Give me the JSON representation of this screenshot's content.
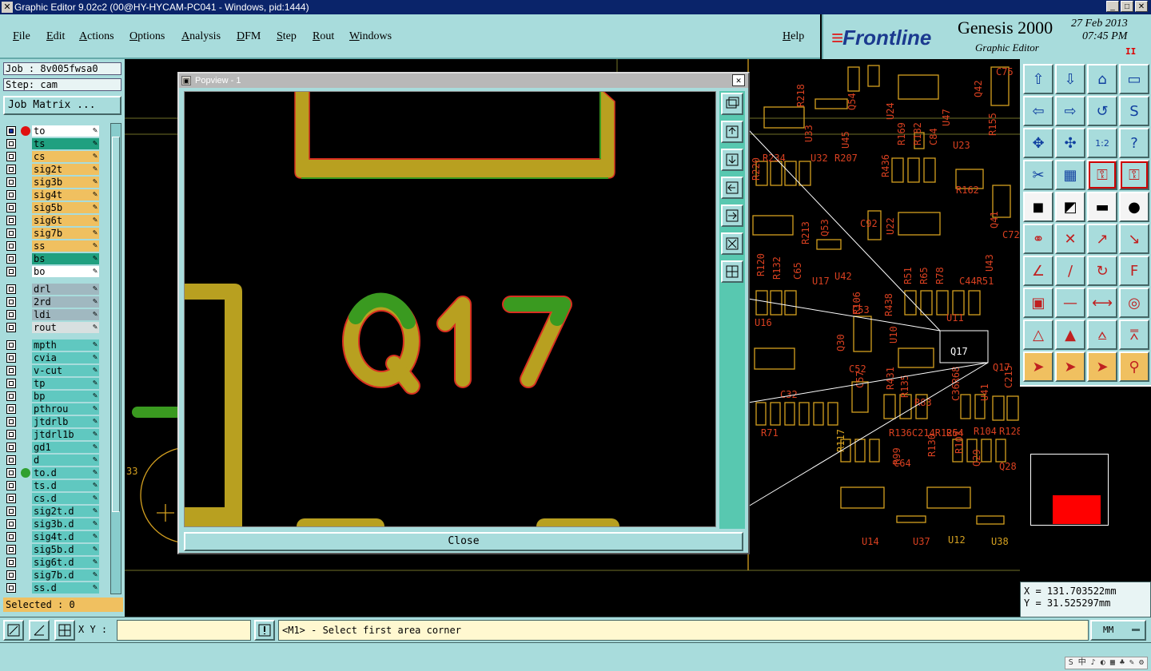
{
  "window": {
    "title": "Graphic Editor 9.02c2 (00@HY-HYCAM-PC041 - Windows, pid:1444)"
  },
  "menu": [
    "File",
    "Edit",
    "Actions",
    "Options",
    "Analysis",
    "DFM",
    "Step",
    "Rout",
    "Windows"
  ],
  "help_label": "Help",
  "brand": {
    "logo": "Frontline",
    "product": "Genesis 2000",
    "subtitle": "Graphic Editor",
    "date": "27 Feb 2013",
    "time": "07:45 PM",
    "pause_glyph": "II"
  },
  "job": {
    "job_line": "Job : 8v005fwsa0",
    "step_line": "Step: cam",
    "matrix_button": "Job Matrix ..."
  },
  "layers": [
    {
      "name": "to",
      "color": "#ffffff",
      "dot": "#e01010",
      "active": true
    },
    {
      "name": "ts",
      "color": "#20a080"
    },
    {
      "name": "cs",
      "color": "#f0c060"
    },
    {
      "name": "sig2t",
      "color": "#f0c060"
    },
    {
      "name": "sig3b",
      "color": "#f0c060"
    },
    {
      "name": "sig4t",
      "color": "#f0c060"
    },
    {
      "name": "sig5b",
      "color": "#f0c060"
    },
    {
      "name": "sig6t",
      "color": "#f0c060"
    },
    {
      "name": "sig7b",
      "color": "#f0c060"
    },
    {
      "name": "ss",
      "color": "#f0c060"
    },
    {
      "name": "bs",
      "color": "#20a080"
    },
    {
      "name": "bo",
      "color": "#ffffff"
    },
    {
      "name": "drl",
      "color": "#a0b8c0"
    },
    {
      "name": "2rd",
      "color": "#a0b8c0"
    },
    {
      "name": "ldi",
      "color": "#a0b8c0"
    },
    {
      "name": "rout",
      "color": "#d8e0e0"
    },
    {
      "name": "mpth",
      "color": "#60c8c0"
    },
    {
      "name": "cvia",
      "color": "#60c8c0"
    },
    {
      "name": "v-cut",
      "color": "#60c8c0"
    },
    {
      "name": "tp",
      "color": "#60c8c0"
    },
    {
      "name": "bp",
      "color": "#60c8c0"
    },
    {
      "name": "pthrou",
      "color": "#60c8c0"
    },
    {
      "name": "jtdrlb",
      "color": "#60c8c0"
    },
    {
      "name": "jtdrl1b",
      "color": "#60c8c0"
    },
    {
      "name": "gd1",
      "color": "#60c8c0"
    },
    {
      "name": "d",
      "color": "#60c8c0"
    },
    {
      "name": "to.d",
      "color": "#60c8c0",
      "dot": "#30a030"
    },
    {
      "name": "ts.d",
      "color": "#60c8c0"
    },
    {
      "name": "cs.d",
      "color": "#60c8c0"
    },
    {
      "name": "sig2t.d",
      "color": "#60c8c0"
    },
    {
      "name": "sig3b.d",
      "color": "#60c8c0"
    },
    {
      "name": "sig4t.d",
      "color": "#60c8c0"
    },
    {
      "name": "sig5b.d",
      "color": "#60c8c0"
    },
    {
      "name": "sig6t.d",
      "color": "#60c8c0"
    },
    {
      "name": "sig7b.d",
      "color": "#60c8c0"
    },
    {
      "name": "ss.d",
      "color": "#60c8c0"
    }
  ],
  "selected": "Selected : 0",
  "popview": {
    "title": "Popview - 1",
    "close_label": "Close",
    "designator": "Q17"
  },
  "board_labels": [
    "R218",
    "Q54",
    "U24",
    "Q42",
    "C75",
    "U33",
    "U45",
    "R169",
    "R182",
    "C84",
    "U47",
    "R155",
    "U23",
    "R234",
    "U32",
    "R207",
    "R436",
    "R162",
    "R220",
    "C92",
    "U22",
    "Q41",
    "C72",
    "R213",
    "Q53",
    "R120",
    "R132",
    "C65",
    "U42",
    "U17",
    "R51",
    "R65",
    "R78",
    "C44R51",
    "U43",
    "U16",
    "C53",
    "R106",
    "R438",
    "U11",
    "U10",
    "Q30",
    "Q17",
    "C52",
    "R431",
    "C32",
    "C57",
    "R135",
    "R83",
    "C36R68",
    "U41",
    "C215",
    "R71",
    "R136C214R125",
    "R130",
    "R64",
    "R103",
    "R104",
    "R128",
    "R99",
    "C64",
    "Q29",
    "Q28",
    "U14",
    "U37",
    "U12",
    "U38",
    "R117"
  ],
  "coords": {
    "x": "X = 131.703522mm",
    "y": "Y = 31.525297mm"
  },
  "bottom": {
    "xy_label": "X Y :",
    "xy_value": "",
    "prompt": "<M1> - Select first area corner",
    "units": "MM"
  },
  "tray_text": "S 中 ♪ ◐ ▦ ♣ ✎ ⚙"
}
